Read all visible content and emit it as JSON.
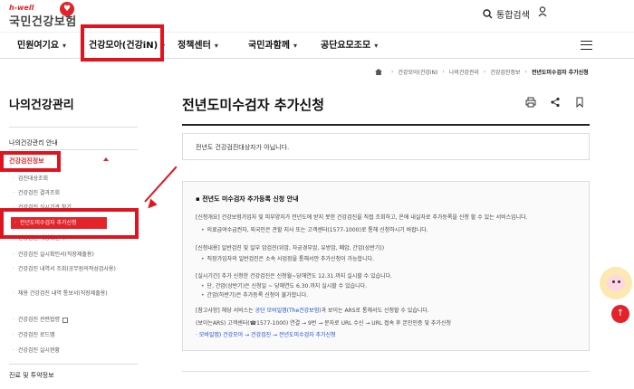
{
  "brand": {
    "sub": "h-well",
    "name": "국민건강보험"
  },
  "top": {
    "search_label": "통합검색"
  },
  "nav": [
    {
      "label": "민원여기요"
    },
    {
      "label": "건강모아(건강iN)"
    },
    {
      "label": "정책센터"
    },
    {
      "label": "국민과함께"
    },
    {
      "label": "공단요모조모"
    }
  ],
  "breadcrumb": [
    "건강모아(건강iN)",
    "나의건강관리",
    "건강검진정보",
    "전년도미수검자 추가신청"
  ],
  "sidebar": {
    "title": "나의건강관리",
    "guide": "나의건강관리 안내",
    "section": "건강검진정보",
    "items": [
      "검진대상조회",
      "건강검진 결과조회",
      "건강검진 실시기관 찾기",
      "전년도미수검자 추가신청",
      "건강검진 대상확인서",
      "건강검진 실시확인서(직장제출용)",
      "건강검진 내역서 조회(공무원의적성검사용)",
      "채용 건강검진 내역 통보서(직장제출용)",
      "건강검진 관련법령",
      "건강검진 로드맵",
      "건강검진 실시현황"
    ],
    "next": "진료 및 투약정보"
  },
  "content": {
    "title": "전년도미수검자 추가신청",
    "notice": "전년도 건강검진대상자가 아닙니다.",
    "info_title": "전년도 미수검자 추가등록 신청 안내",
    "lines": [
      "[신청개요] 건강보험가입자 및 피부양자가 전년도에 받지 못한 건강검진을 직접 조회하고, 온에 내실자로 추가등록을 신청 할 수 있는 서비스입니다.",
      "의료급여수급권자, 외국인은 관할 지사 또는 고객센터(1577-1000)로 통해 신청하시기 바랍니다.",
      "[신청내용] 일반검진 및 일부 암검진(위암, 자궁경부암, 유방암, 폐암, 간암(상반기))",
      "직장가입자의 일반검진은 소속 사업장을 통해서만 추가신청이 가능합니다.",
      "[실시기간] 추가 신청한 건강검진은 신청월~당해연도 12.31.까지 실시할 수 있습니다.",
      "단, 간암(상반기)은 신청일 ~ 당해연도 6.30.까지 실시할 수 있습니다.",
      "간암(하반기)은 추가등록 신청이 불가합니다.",
      "[참고사항] 해당 서비스는 ",
      "공단 모바일앱(The건강보험)",
      "과 보이는 ARS로 통해서도 신청할 수 있습니다.",
      "(보이는ARS) 고객센터(☎1577-1000) 연결 → 9번 → 문자로 URL 수신 → URL 접속 후 본인인증 및 추가신청",
      "· 모바일앱) 건강모아 → 건강검진 → 전년도미수검자 추가신청"
    ]
  },
  "colors": {
    "accent": "#e2232a",
    "highlight": "#e0141e",
    "link": "#1a4fc7"
  },
  "icons": [
    "search-icon",
    "user-icon",
    "menu-icon",
    "home-icon",
    "print-icon",
    "share-icon",
    "bookmark-icon",
    "scroll-top-icon"
  ]
}
